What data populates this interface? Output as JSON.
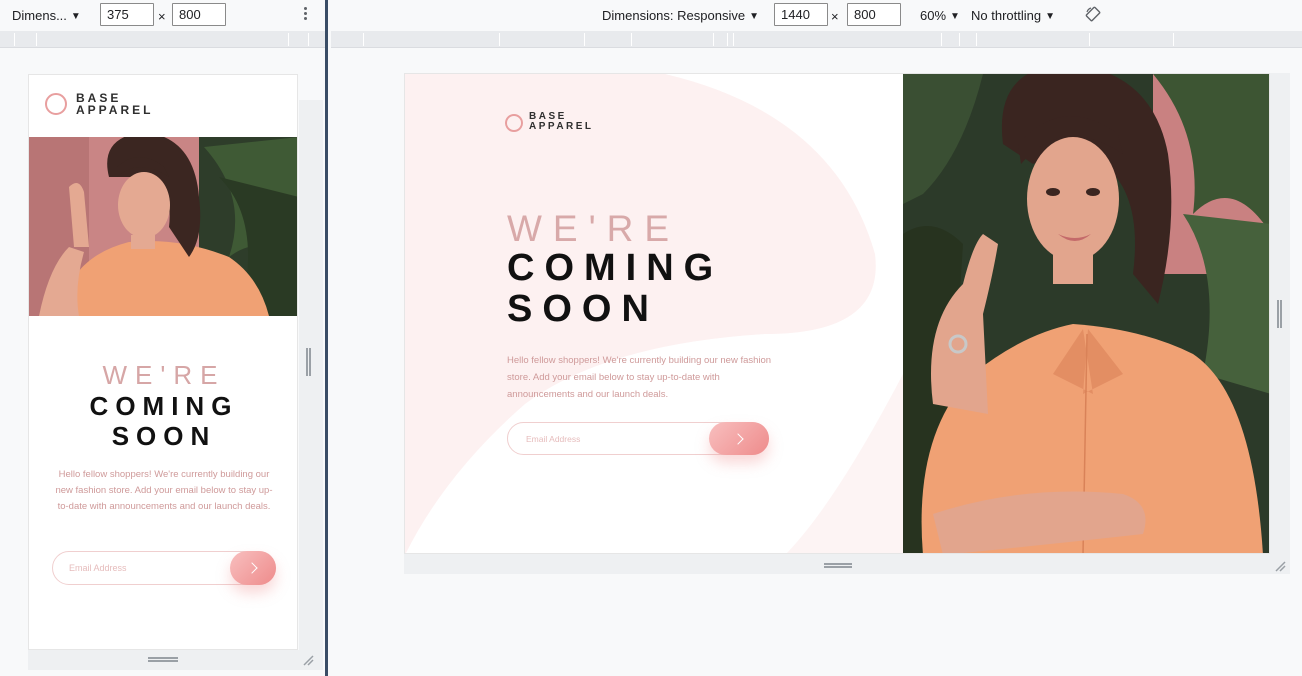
{
  "left_toolbar": {
    "device_label": "Dimens...",
    "width_value": "375",
    "times": "×",
    "height_value": "800"
  },
  "right_toolbar": {
    "device_label": "Dimensions: Responsive",
    "width_value": "1440",
    "times": "×",
    "height_value": "800",
    "zoom": "60%",
    "throttling": "No throttling"
  },
  "site": {
    "logo_line1": "BASE",
    "logo_line2": "APPAREL",
    "heading_light": "WE'RE",
    "heading_bold_1": "COMING",
    "heading_bold_2": "SOON",
    "description": "Hello fellow shoppers! We're currently building our new fashion store. Add your email below to stay up-to-date with announcements and our launch deals.",
    "email_placeholder": "Email Address"
  },
  "colors": {
    "accent": "#e89f9f",
    "text_pink": "#cf9a9a",
    "shirt": "#f0a174"
  },
  "icons": {
    "dropdown": "caret-down-icon",
    "menu": "kebab-icon",
    "rotate": "rotate-icon",
    "submit": "chevron-right-icon",
    "logo": "circle-logo-icon"
  }
}
